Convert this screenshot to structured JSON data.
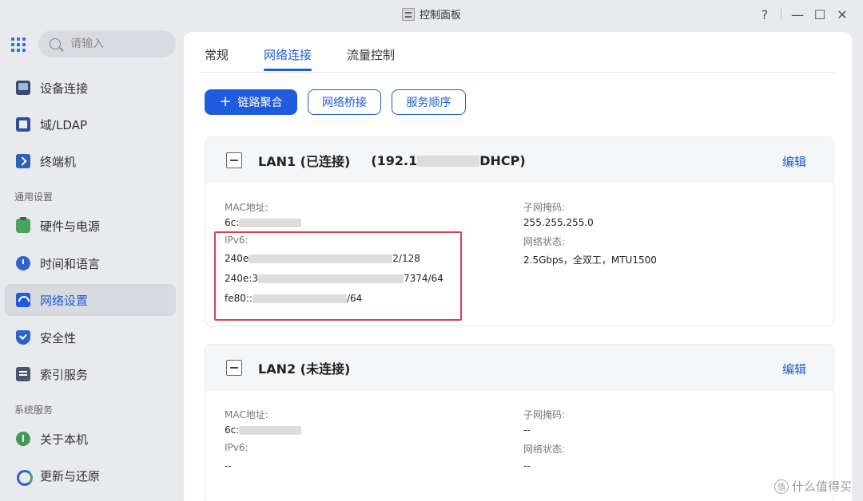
{
  "window": {
    "title": "控制面板",
    "controls": {
      "help": "?",
      "minimize": "—",
      "maximize": "☐",
      "close": "✕"
    }
  },
  "sidebar": {
    "search_placeholder": "请输入",
    "items": [
      {
        "label": "设备连接",
        "icon": "device-icon"
      },
      {
        "label": "域/LDAP",
        "icon": "ldap-icon"
      },
      {
        "label": "终端机",
        "icon": "terminal-icon"
      },
      {
        "label": "硬件与电源",
        "icon": "hardware-icon"
      },
      {
        "label": "时间和语言",
        "icon": "time-icon"
      },
      {
        "label": "网络设置",
        "icon": "network-icon",
        "active": true
      },
      {
        "label": "安全性",
        "icon": "shield-icon"
      },
      {
        "label": "索引服务",
        "icon": "index-icon"
      },
      {
        "label": "关于本机",
        "icon": "info-icon"
      },
      {
        "label": "更新与还原",
        "icon": "update-icon"
      }
    ],
    "sections": {
      "general": "通用设置",
      "system": "系统服务"
    }
  },
  "tabs": [
    {
      "label": "常规"
    },
    {
      "label": "网络连接",
      "active": true
    },
    {
      "label": "流量控制"
    }
  ],
  "actions": {
    "aggregate": "链路聚合",
    "aggregate_plus": "+",
    "bridge": "网络桥接",
    "order": "服务顺序"
  },
  "lan1": {
    "title": "LAN1 (已连接)",
    "ip_prefix": "(192.1",
    "ip_suffix": "DHCP)",
    "edit": "编辑",
    "mac_label": "MAC地址:",
    "mac_value": "6c:",
    "ipv6_label": "IPv6:",
    "ipv6_1_prefix": "240e",
    "ipv6_1_suffix": "2/128",
    "ipv6_2_prefix": "240e:3",
    "ipv6_2_suffix": "7374/64",
    "ipv6_3_prefix": "fe80::",
    "ipv6_3_suffix": "/64",
    "mask_label": "子网掩码:",
    "mask_value": "255.255.255.0",
    "status_label": "网络状态:",
    "status_value": "2.5Gbps，全双工，MTU1500"
  },
  "lan2": {
    "title": "LAN2 (未连接)",
    "edit": "编辑",
    "mac_label": "MAC地址:",
    "mac_value": "6c:",
    "ipv6_label": "IPv6:",
    "ipv6_value": "--",
    "mask_label": "子网掩码:",
    "mask_value": "--",
    "status_label": "网络状态:",
    "status_value": "--"
  },
  "watermark": {
    "text": "什么值得买",
    "icon": "值"
  }
}
